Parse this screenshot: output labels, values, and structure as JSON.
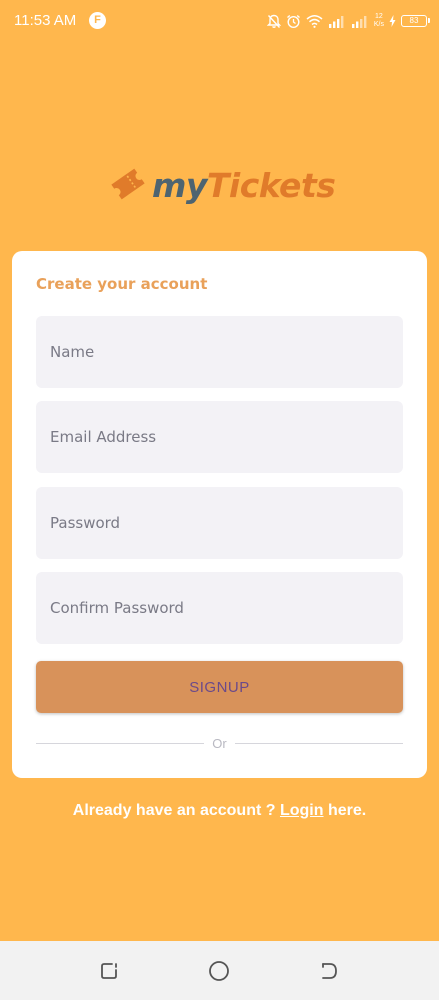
{
  "status_bar": {
    "time": "11:53 AM",
    "app_badge": "F",
    "net_speed_value": "12",
    "net_speed_unit": "K/s",
    "battery_level": "83"
  },
  "logo": {
    "part1": "my",
    "part2": "Tickets"
  },
  "form": {
    "title": "Create your account",
    "name_placeholder": "Name",
    "email_placeholder": "Email Address",
    "password_placeholder": "Password",
    "confirm_placeholder": "Confirm Password",
    "signup_label": "SIGNUP",
    "divider_text": "Or"
  },
  "footer": {
    "prefix": "Already have an account ? ",
    "login_label": "Login",
    "suffix": " here."
  },
  "colors": {
    "background": "#FFB74D",
    "accent": "#E07B2A",
    "button": "#D8925A"
  }
}
